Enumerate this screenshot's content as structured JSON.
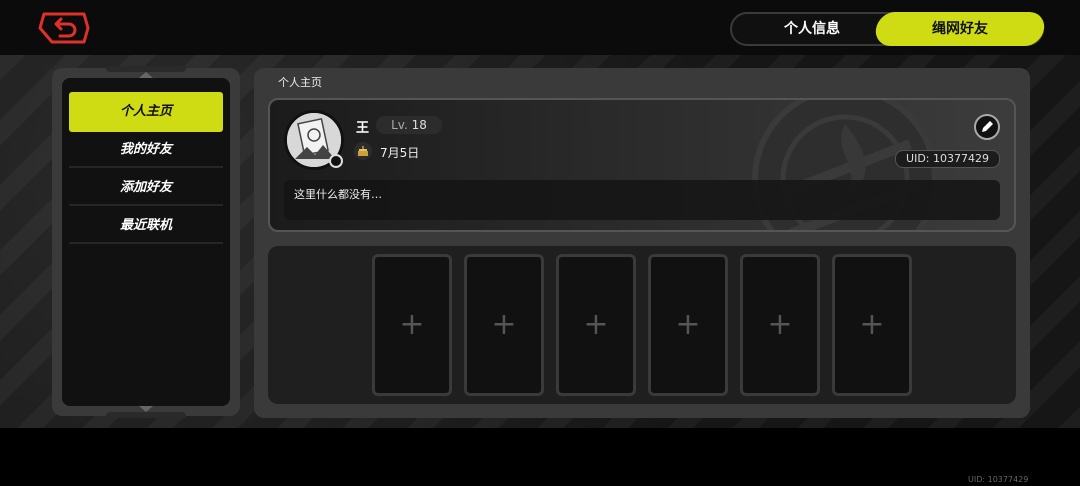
{
  "top_tabs": {
    "info_label": "个人信息",
    "friends_label": "绳网好友"
  },
  "menu": {
    "items": [
      {
        "label": "个人主页",
        "active": true
      },
      {
        "label": "我的好友",
        "active": false
      },
      {
        "label": "添加好友",
        "active": false
      },
      {
        "label": "最近联机",
        "active": false
      }
    ]
  },
  "main": {
    "title": "个人主页"
  },
  "profile": {
    "username": "王",
    "level_prefix": "Lv.",
    "level": "18",
    "birthday": "7月5日",
    "uid": "UID: 10377429",
    "bio": "这里什么都没有…"
  },
  "slots": [
    {
      "symbol": "+"
    },
    {
      "symbol": "+"
    },
    {
      "symbol": "+"
    },
    {
      "symbol": "+"
    },
    {
      "symbol": "+"
    },
    {
      "symbol": "+"
    }
  ],
  "footer": {
    "uid": "UID: 10377429"
  },
  "colors": {
    "accent": "#cfdc14",
    "back_button": "#e0302a"
  },
  "icons": {
    "back": "return-arrow-icon",
    "edit": "pencil-icon",
    "birthday": "cake-icon",
    "add": "plus-icon"
  }
}
